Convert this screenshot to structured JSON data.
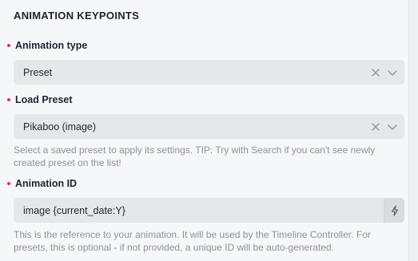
{
  "section": {
    "title": "ANIMATION KEYPOINTS"
  },
  "animation_type": {
    "label": "Animation type",
    "value": "Preset"
  },
  "load_preset": {
    "label": "Load Preset",
    "value": "Pikaboo (image)",
    "help_line1": "Select a saved preset to apply its settings. TIP: Try with Search if you can't see newly",
    "help_line2": "created preset on the list!"
  },
  "animation_id": {
    "label": "Animation ID",
    "value": "image {current_date:Y}",
    "help_line1": "This is the reference to your animation. It will be used by the Timeline Controller. For",
    "help_line2": "presets, this is optional - if not provided, a unique ID will be auto-generated."
  },
  "icons": {
    "clear": "close-icon",
    "dropdown": "chevron-down-icon",
    "generate": "lightning-icon"
  },
  "colors": {
    "required": "#d6336c",
    "field_bg": "#e5e7ea",
    "help_text": "#8a939d"
  }
}
